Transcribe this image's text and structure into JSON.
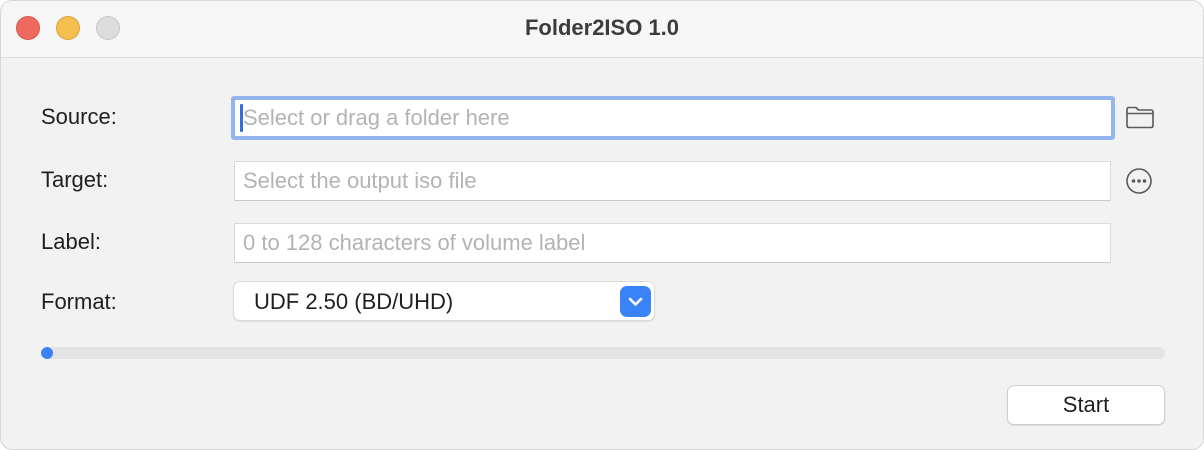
{
  "window": {
    "title": "Folder2ISO 1.0"
  },
  "form": {
    "source": {
      "label": "Source:",
      "placeholder": "Select or drag a folder here",
      "value": "",
      "icon": "folder-icon"
    },
    "target": {
      "label": "Target:",
      "placeholder": "Select the output iso file",
      "value": "",
      "icon": "ellipsis-circle-icon"
    },
    "volume_label": {
      "label": "Label:",
      "placeholder": "0 to 128 characters of volume label",
      "value": ""
    },
    "format": {
      "label": "Format:",
      "selected": "UDF 2.50 (BD/UHD)",
      "icon": "chevron-down-icon"
    }
  },
  "progress": {
    "percent": 0
  },
  "actions": {
    "start_label": "Start"
  },
  "colors": {
    "accent": "#3a82f7",
    "focus_ring": "#93b4ec",
    "close": "#ec6a5e",
    "minimize": "#f4bf4f",
    "zoom_inactive": "#dcdcdc"
  }
}
